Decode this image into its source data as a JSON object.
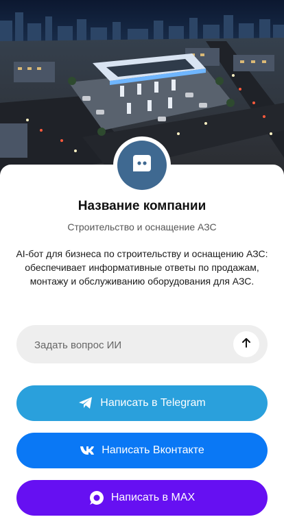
{
  "company": {
    "name": "Название компании",
    "subtitle": "Строительство и оснащение АЗС",
    "description": "AI-бот для бизнеса по строительству и оснащению АЗС: обеспечивает информативные ответы по продажам, монтажу и обслуживанию оборудования для АЗС."
  },
  "ask": {
    "placeholder": "Задать вопрос ИИ"
  },
  "buttons": {
    "telegram": {
      "label": "Написать в Telegram",
      "color": "#2aa0dc",
      "icon": "telegram-icon"
    },
    "vk": {
      "label": "Написать Вконтакте",
      "color": "#0a78f5",
      "icon": "vk-icon"
    },
    "max": {
      "label": "Написать в MAX",
      "color": "#6610f2",
      "icon": "max-icon"
    }
  },
  "colors": {
    "avatar_bg": "#3f6991",
    "ask_bg": "#eeeeee"
  }
}
